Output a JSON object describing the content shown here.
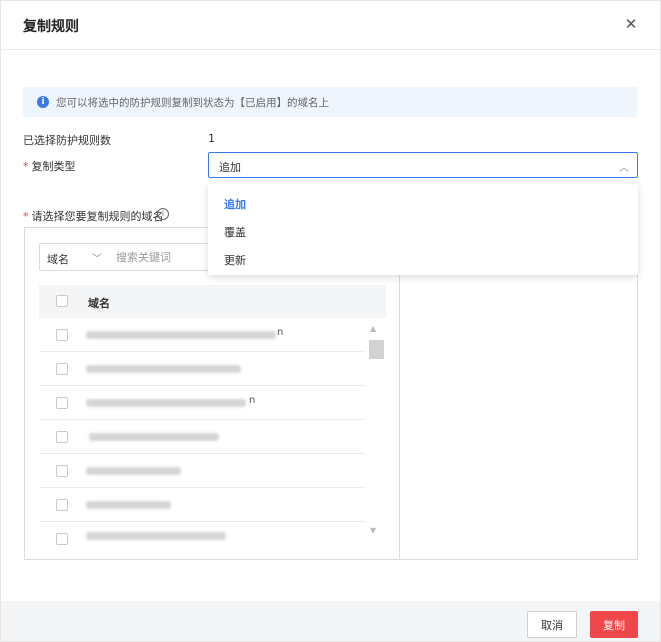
{
  "dialog": {
    "title": "复制规则",
    "close_icon": "close-icon"
  },
  "info": {
    "icon": "info-icon",
    "text": "您可以将选中的防护规则复制到状态为【已启用】的域名上"
  },
  "form": {
    "selected_count_label": "已选择防护规则数",
    "selected_count_value": "1",
    "copy_type_label": "复制类型",
    "copy_type_value": "追加",
    "copy_type_options": [
      "追加",
      "覆盖",
      "更新"
    ],
    "domain_select_label": "请选择您要复制规则的域名",
    "required_mark": "*"
  },
  "filter": {
    "field": "域名",
    "placeholder": "搜索关键词"
  },
  "table": {
    "column_header": "域名",
    "rows": [
      {
        "tail": "n"
      },
      {
        "tail": ""
      },
      {
        "tail": "n"
      },
      {
        "tail": ""
      },
      {
        "tail": ""
      },
      {
        "tail": ""
      },
      {
        "tail": ""
      }
    ]
  },
  "footer": {
    "cancel_label": "取消",
    "confirm_label": "复制"
  },
  "colors": {
    "accent": "#3a7ae8",
    "danger": "#f0474b",
    "info_bg": "#eef5fd"
  }
}
